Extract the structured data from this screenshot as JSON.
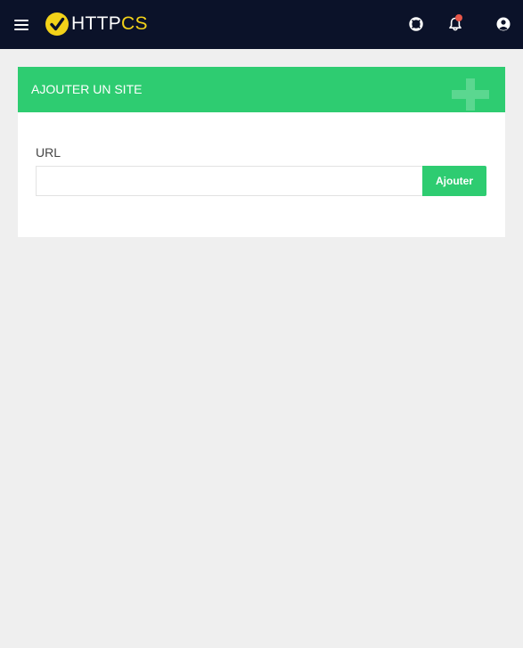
{
  "header": {
    "brand_part1": "HTTP",
    "brand_part2": "CS",
    "icons": [
      "menu-icon",
      "help-lifebuoy-icon",
      "bell-icon",
      "user-account-icon"
    ],
    "colors": {
      "bar_background": "#0b1229",
      "brand_yellow": "#f3d219",
      "notification_dot": "#e8574a"
    }
  },
  "card": {
    "title": "AJOUTER UN SITE",
    "accent_color": "#2ecc71",
    "header_decoration": "plus-icon",
    "url_label": "URL",
    "url_value": "",
    "url_placeholder": "",
    "submit_label": "Ajouter"
  }
}
